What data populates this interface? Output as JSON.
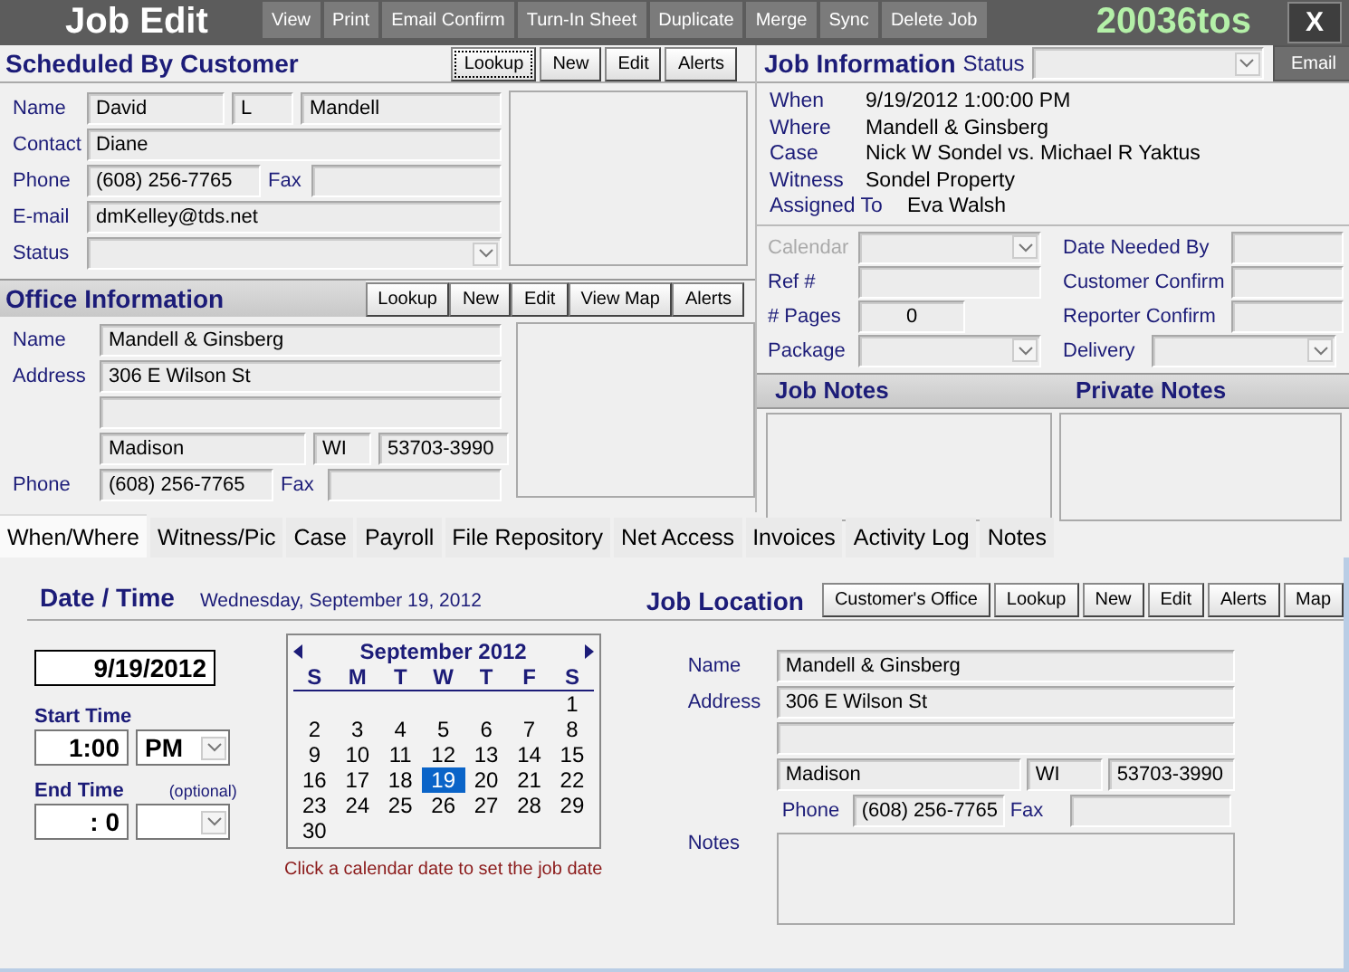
{
  "window": {
    "title": "Job Edit",
    "job_number": "20036tos",
    "close_label": "X"
  },
  "toolbar": [
    {
      "label": "View"
    },
    {
      "label": "Print"
    },
    {
      "label": "Email Confirm"
    },
    {
      "label": "Turn-In Sheet"
    },
    {
      "label": "Duplicate"
    },
    {
      "label": "Merge"
    },
    {
      "label": "Sync"
    },
    {
      "label": "Delete Job"
    }
  ],
  "customer": {
    "title": "Scheduled By Customer",
    "buttons": [
      {
        "label": "Lookup",
        "focused": true
      },
      {
        "label": "New",
        "focused": false
      },
      {
        "label": "Edit",
        "focused": false
      },
      {
        "label": "Alerts",
        "focused": false
      }
    ],
    "name_label": "Name",
    "first_name": "David",
    "middle_initial": "L",
    "last_name": "Mandell",
    "contact_label": "Contact",
    "contact": "Diane",
    "phone_label": "Phone",
    "phone": "(608) 256-7765",
    "fax_label": "Fax",
    "email_label": "E-mail",
    "email": "dmKelley@tds.net",
    "status_label": "Status"
  },
  "office": {
    "title": "Office Information",
    "buttons": [
      "Lookup",
      "New",
      "Edit",
      "View Map",
      "Alerts"
    ],
    "name_label": "Name",
    "name": "Mandell & Ginsberg",
    "address_label": "Address",
    "address_line1": "306 E Wilson St",
    "city": "Madison",
    "state": "WI",
    "zip": "53703-3990",
    "phone_label": "Phone",
    "phone": "(608) 256-7765",
    "fax_label": "Fax"
  },
  "job_info": {
    "title": "Job Information",
    "status_label": "Status",
    "email_button": "Email",
    "details": [
      {
        "label": "When",
        "value": "9/19/2012 1:00:00 PM"
      },
      {
        "label": "Where",
        "value": "Mandell & Ginsberg"
      },
      {
        "label": "Case",
        "value": "Nick W Sondel vs. Michael R Yaktus"
      },
      {
        "label": "Witness",
        "value": "Sondel Property"
      },
      {
        "label": "Assigned To",
        "value": "Eva Walsh"
      }
    ],
    "fields": [
      {
        "label": "Calendar",
        "kind": "select",
        "disabled": true
      },
      {
        "label": "Date Needed By",
        "kind": "text",
        "disabled": false
      },
      {
        "label": "Ref #",
        "kind": "text",
        "disabled": false
      },
      {
        "label": "Customer Confirm",
        "kind": "text",
        "disabled": false
      },
      {
        "label": "# Pages",
        "kind": "number",
        "value": "0",
        "disabled": false
      },
      {
        "label": "Reporter Confirm",
        "kind": "text",
        "disabled": false
      },
      {
        "label": "Package",
        "kind": "select",
        "disabled": false
      },
      {
        "label": "Delivery",
        "kind": "select",
        "disabled": false
      }
    ],
    "notes_headers": [
      "Job Notes",
      "Private Notes"
    ]
  },
  "tabs": [
    {
      "label": "When/Where",
      "selected": true
    },
    {
      "label": "Witness/Pic",
      "selected": false
    },
    {
      "label": "Case",
      "selected": false
    },
    {
      "label": "Payroll",
      "selected": false
    },
    {
      "label": "File Repository",
      "selected": false
    },
    {
      "label": "Net Access",
      "selected": false
    },
    {
      "label": "Invoices",
      "selected": false
    },
    {
      "label": "Activity Log",
      "selected": false
    },
    {
      "label": "Notes",
      "selected": false
    }
  ],
  "date_time": {
    "title": "Date / Time",
    "long_date": "Wednesday, September 19, 2012",
    "date": "9/19/2012",
    "start_label": "Start Time",
    "start_time": "1:00",
    "start_ampm": "PM",
    "end_label": "End Time",
    "optional_note": "(optional)",
    "end_time": ": 0",
    "calendar": {
      "month": "September 2012",
      "weekdays": [
        "S",
        "M",
        "T",
        "W",
        "T",
        "F",
        "S"
      ],
      "weeks": [
        [
          {
            "day": "1",
            "selected": false
          }
        ],
        [
          {
            "day": "2",
            "selected": false
          },
          {
            "day": "3",
            "selected": false
          },
          {
            "day": "4",
            "selected": false
          },
          {
            "day": "5",
            "selected": false
          },
          {
            "day": "6",
            "selected": false
          },
          {
            "day": "7",
            "selected": false
          },
          {
            "day": "8",
            "selected": false
          }
        ],
        [
          {
            "day": "9",
            "selected": false
          },
          {
            "day": "10",
            "selected": false
          },
          {
            "day": "11",
            "selected": false
          },
          {
            "day": "12",
            "selected": false
          },
          {
            "day": "13",
            "selected": false
          },
          {
            "day": "14",
            "selected": false
          },
          {
            "day": "15",
            "selected": false
          }
        ],
        [
          {
            "day": "16",
            "selected": false
          },
          {
            "day": "17",
            "selected": false
          },
          {
            "day": "18",
            "selected": false
          },
          {
            "day": "19",
            "selected": true
          },
          {
            "day": "20",
            "selected": false
          },
          {
            "day": "21",
            "selected": false
          },
          {
            "day": "22",
            "selected": false
          }
        ],
        [
          {
            "day": "23",
            "selected": false
          },
          {
            "day": "24",
            "selected": false
          },
          {
            "day": "25",
            "selected": false
          },
          {
            "day": "26",
            "selected": false
          },
          {
            "day": "27",
            "selected": false
          },
          {
            "day": "28",
            "selected": false
          },
          {
            "day": "29",
            "selected": false
          }
        ],
        [
          {
            "day": "30",
            "selected": false
          }
        ]
      ]
    },
    "hint": "Click a calendar date to set the job date"
  },
  "location": {
    "title": "Job Location",
    "buttons": [
      "Customer's Office",
      "Lookup",
      "New",
      "Edit",
      "Alerts",
      "Map"
    ],
    "name_label": "Name",
    "name": "Mandell & Ginsberg",
    "address_label": "Address",
    "address_line1": "306 E Wilson St",
    "city": "Madison",
    "state": "WI",
    "zip": "53703-3990",
    "phone_label": "Phone",
    "phone": "(608) 256-7765",
    "fax_label": "Fax",
    "notes_label": "Notes"
  }
}
